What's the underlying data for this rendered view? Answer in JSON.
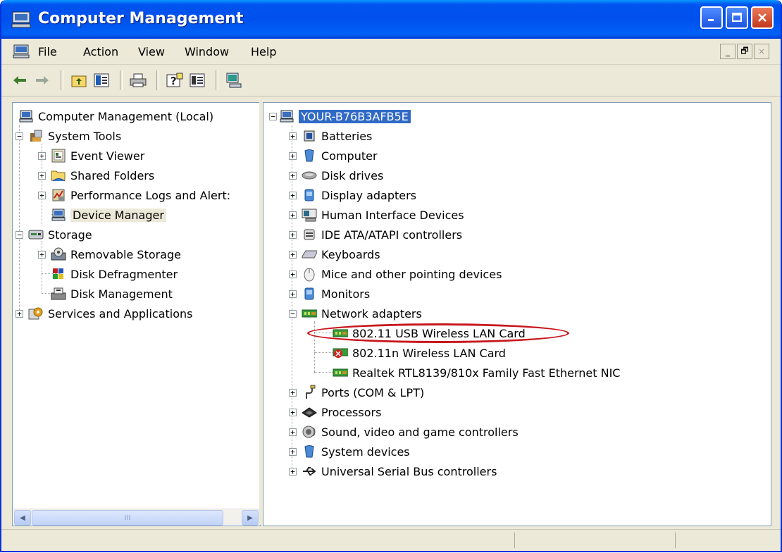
{
  "window": {
    "title": "Computer Management",
    "colors": {
      "titlebar": "#0053ee",
      "selection": "#316ac5",
      "highlight_oval": "#c8161d"
    }
  },
  "menu": {
    "items": [
      "File",
      "Action",
      "View",
      "Window",
      "Help"
    ],
    "mdi_buttons": [
      "_",
      "🗗",
      "×"
    ]
  },
  "toolbar": {
    "icons": [
      "back-arrow-icon",
      "forward-arrow-icon",
      "up-folder-icon",
      "show-hide-tree-icon",
      "print-icon",
      "help-icon",
      "properties-icon",
      "computer-icon"
    ]
  },
  "left_tree": {
    "root": "Computer Management (Local)",
    "system_tools": "System Tools",
    "event_viewer": "Event Viewer",
    "shared_folders": "Shared Folders",
    "performance_logs": "Performance Logs and Alert:",
    "device_manager": "Device Manager",
    "storage": "Storage",
    "removable_storage": "Removable Storage",
    "disk_defragmenter": "Disk Defragmenter",
    "disk_management": "Disk Management",
    "services_apps": "Services and Applications",
    "scroll_thumb_grip": "III"
  },
  "right_tree": {
    "host": "YOUR-B76B3AFB5E",
    "categories": [
      "Batteries",
      "Computer",
      "Disk drives",
      "Display adapters",
      "Human Interface Devices",
      "IDE ATA/ATAPI controllers",
      "Keyboards",
      "Mice and other pointing devices",
      "Monitors",
      "Network adapters"
    ],
    "network_adapters": [
      "802.11 USB Wireless LAN Card",
      "802.11n Wireless LAN Card",
      "Realtek RTL8139/810x Family Fast Ethernet NIC"
    ],
    "after_categories": [
      "Ports (COM & LPT)",
      "Processors",
      "Sound, video and game controllers",
      "System devices",
      "Universal Serial Bus controllers"
    ]
  }
}
